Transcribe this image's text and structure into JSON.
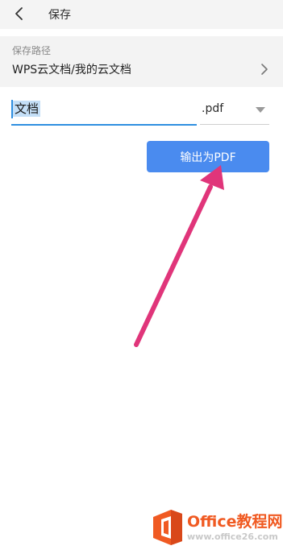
{
  "header": {
    "title": "保存",
    "back_icon": "chevron-left-icon"
  },
  "save_path": {
    "caption": "保存路径",
    "value": "WPS云文档/我的云文档",
    "icon": "chevron-right-icon"
  },
  "file": {
    "name": "文档",
    "format": ".pdf",
    "format_icon": "dropdown-triangle-icon"
  },
  "actions": {
    "export_label": "输出为PDF"
  },
  "colors": {
    "accent": "#4a8bef",
    "input_underline": "#2f8fe0",
    "arrow": "#e0357a",
    "watermark_orange": "#f05a22"
  },
  "watermark": {
    "title": "Office教程网",
    "url": "www.office26.com"
  }
}
